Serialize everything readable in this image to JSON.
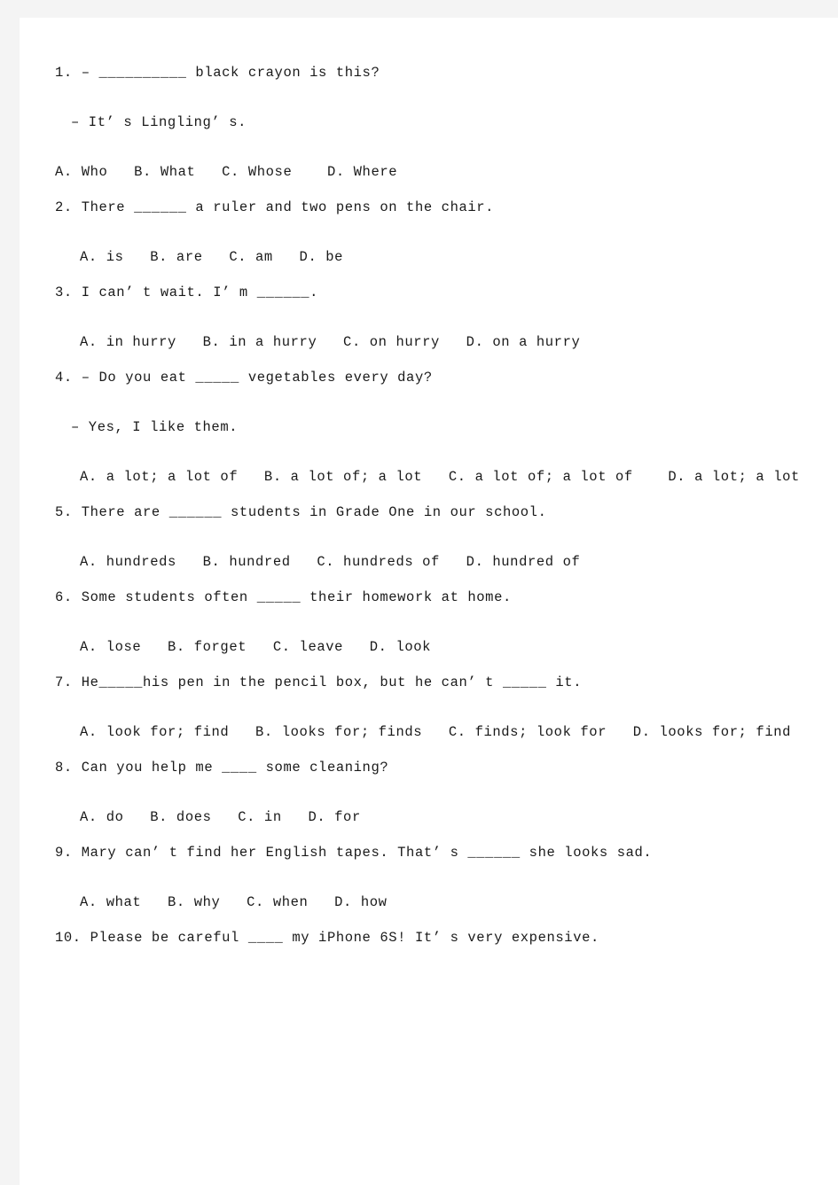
{
  "document": {
    "type": "english-grammar-worksheet",
    "page_background": "#f4f4f4",
    "sheet_background": "#ffffff",
    "text_color": "#1a1a1a"
  },
  "questions": [
    {
      "number": "1.",
      "stem": "1. – __________ black crayon is this?",
      "reply": "– It’ s Lingling’ s.",
      "options": "A. Who   B. What   C. Whose    D. Where",
      "options_flush": true
    },
    {
      "number": "2.",
      "stem": "2. There ______ a ruler and two pens on the chair.",
      "options": "A. is   B. are   C. am   D. be"
    },
    {
      "number": "3.",
      "stem": "3. I can’ t wait. I’ m ______.",
      "options": "A. in hurry   B. in a hurry   C. on hurry   D. on a hurry"
    },
    {
      "number": "4.",
      "stem": "4. – Do you eat _____ vegetables every day?",
      "reply": "– Yes, I like them.",
      "options": "A. a lot; a lot of   B. a lot of; a lot   C. a lot of; a lot of    D. a lot; a lot"
    },
    {
      "number": "5.",
      "stem": "5. There are ______ students in Grade One in our school.",
      "options": "A. hundreds   B. hundred   C. hundreds of   D. hundred of"
    },
    {
      "number": "6.",
      "stem": "6. Some students often _____ their homework at home.",
      "options": "A. lose   B. forget   C. leave   D. look"
    },
    {
      "number": "7.",
      "stem": "7. He_____his pen in the pencil box, but he can’ t _____ it.",
      "options": "A. look for; find   B. looks for; finds   C. finds; look for   D. looks for; find"
    },
    {
      "number": "8.",
      "stem": "8. Can you help me ____ some cleaning?",
      "options": "A. do   B. does   C. in   D. for"
    },
    {
      "number": "9.",
      "stem": "9. Mary can’ t find her English tapes. That’ s ______ she looks sad.",
      "options": "A. what   B. why   C. when   D. how"
    },
    {
      "number": "10.",
      "stem": "10. Please be careful ____ my iPhone 6S! It’ s very expensive."
    }
  ]
}
